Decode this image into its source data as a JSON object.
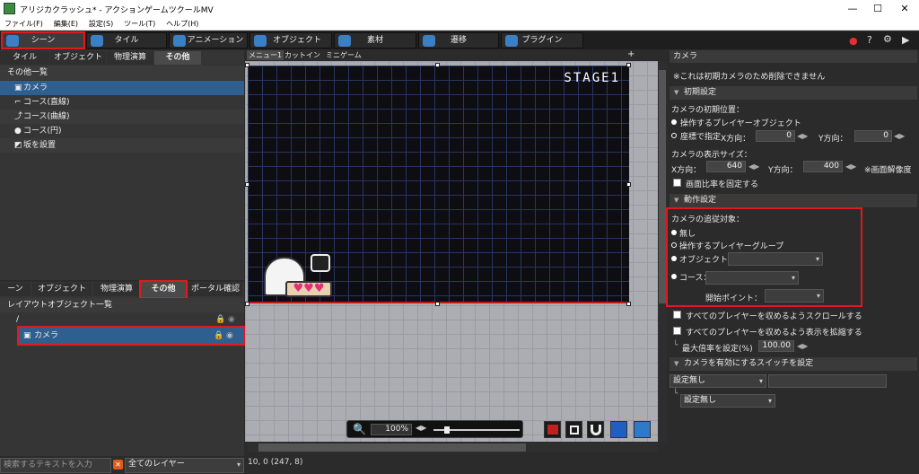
{
  "window": {
    "title": "アリジカクラッシュ* - アクションゲームツクールMV",
    "minimize": "—",
    "maximize": "☐",
    "close": "✕"
  },
  "menu": [
    "ファイル(F)",
    "編集(E)",
    "設定(S)",
    "ツール(T)",
    "ヘルプ(H)"
  ],
  "main_tabs": [
    "シーン",
    "タイル",
    "アニメーション",
    "オブジェクト",
    "素材",
    "遷移",
    "プラグイン"
  ],
  "top_icons": [
    "●",
    "?",
    "⚙",
    "▶"
  ],
  "left_top": {
    "tabs": [
      "タイル",
      "オブジェクト",
      "物理演算",
      "その他"
    ],
    "list_header": "その他一覧",
    "items": [
      "カメラ",
      "コース(直線)",
      "コース(曲線)",
      "コース(円)",
      "坂を設置"
    ]
  },
  "left_bottom": {
    "tabs": [
      "ーン",
      "オブジェクト",
      "物理演算",
      "その他",
      "ポータル確認"
    ],
    "header": "レイアウトオブジェクト一覧",
    "root": "/",
    "item": "カメラ",
    "search_placeholder": "検索するテキストを入力",
    "layer_select": "全てのレイヤー"
  },
  "center": {
    "tabs": [
      "メニュー1",
      "カットイン",
      "ミニゲーム"
    ],
    "stage_label": "STAGE1",
    "zoom": "100%",
    "status": "10, 0 (247, 8)"
  },
  "right": {
    "title": "カメラ",
    "note": "※これは初期カメラのため削除できません",
    "sec_initial": "初期設定",
    "init_pos_label": "カメラの初期位置：",
    "opt_player_obj": "操作するプレイヤーオブジェクト",
    "opt_coords": "座標で指定",
    "x_dir": "X方向：",
    "y_dir": "Y方向：",
    "init_x": "0",
    "init_y": "0",
    "size_label": "カメラの表示サイズ：",
    "x_dir2": "X方向：",
    "y_dir2": "Y方向：",
    "size_x": "640",
    "size_y": "400",
    "res_note": "※画面解像度",
    "fix_ratio": "画面比率を固定する",
    "sec_action": "動作設定",
    "follow_label": "カメラの追従対象：",
    "f_none": "無し",
    "f_group": "操作するプレイヤーグループ",
    "f_object": "オブジェクト：",
    "f_course": "コース：",
    "start_point": "開始ポイント：",
    "scroll_all": "すべてのプレイヤーを収めるようスクロールする",
    "zoom_all": "すべてのプレイヤーを収めるよう表示を拡縮する",
    "max_zoom_label": "最大倍率を設定(%)",
    "max_zoom": "100.00",
    "sec_switch": "カメラを有効にするスイッチを設定",
    "switch1": "設定無し",
    "switch2": "設定無し"
  },
  "colors": {
    "highlight_red": "#e0191f",
    "selected_blue": "#2f5f8e",
    "accent_blue": "#3b7fc4"
  }
}
